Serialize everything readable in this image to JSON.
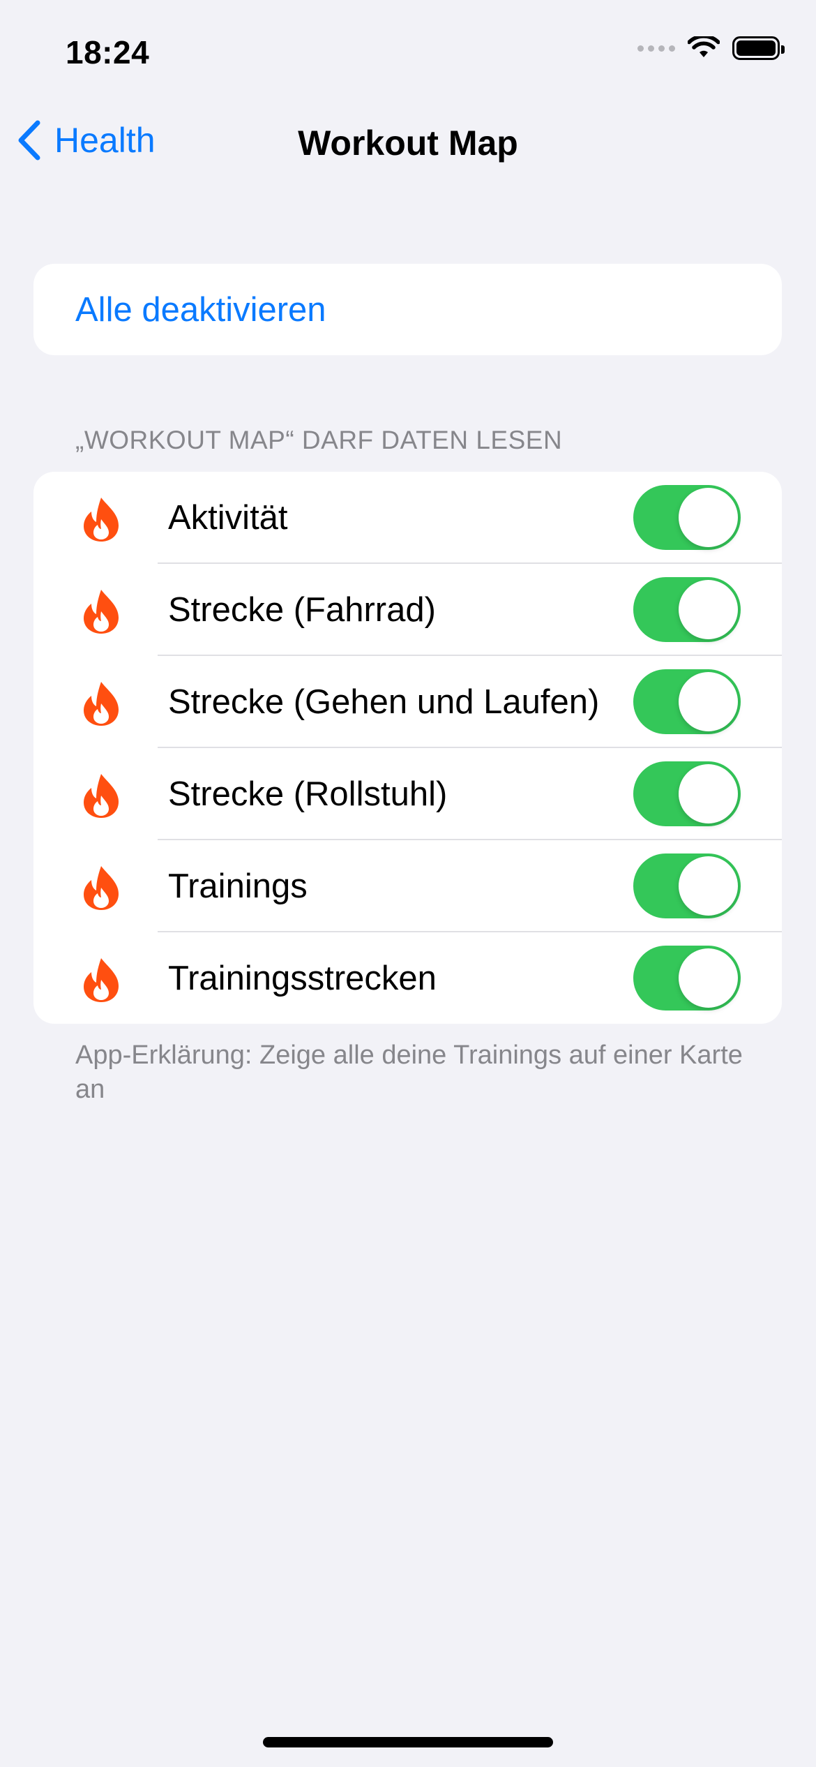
{
  "status_bar": {
    "time": "18:24"
  },
  "nav": {
    "back_label": "Health",
    "title": "Workout Map"
  },
  "action": {
    "label": "Alle deaktivieren"
  },
  "section": {
    "header": "„WORKOUT MAP“ DARF DATEN LESEN"
  },
  "permissions": [
    {
      "label": "Aktivität",
      "enabled": true,
      "icon": "flame-icon"
    },
    {
      "label": "Strecke (Fahrrad)",
      "enabled": true,
      "icon": "flame-icon"
    },
    {
      "label": "Strecke (Gehen und Laufen)",
      "enabled": true,
      "icon": "flame-icon"
    },
    {
      "label": "Strecke (Rollstuhl)",
      "enabled": true,
      "icon": "flame-icon"
    },
    {
      "label": "Trainings",
      "enabled": true,
      "icon": "flame-icon"
    },
    {
      "label": "Trainingsstrecken",
      "enabled": true,
      "icon": "flame-icon"
    }
  ],
  "footer": {
    "note": "App-Erklärung: Zeige alle deine Trainings auf einer Karte an"
  },
  "colors": {
    "accent": "#0a7aff",
    "toggle_on": "#34c759",
    "flame": "#ff4f10",
    "background": "#f2f2f7"
  }
}
